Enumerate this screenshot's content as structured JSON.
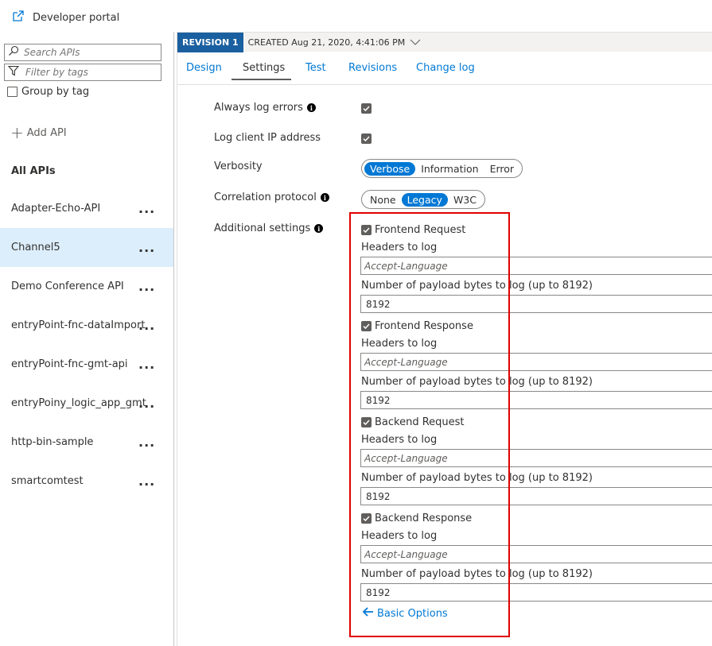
{
  "topbar": {
    "developer_portal": "Developer portal"
  },
  "sidebar": {
    "search_placeholder": "Search APIs",
    "filter_placeholder": "Filter by tags",
    "group_by_tag": "Group by tag",
    "add_api": "Add API",
    "all_apis": "All APIs",
    "apis": [
      {
        "name": "Adapter-Echo-API",
        "selected": false
      },
      {
        "name": "Channel5",
        "selected": true
      },
      {
        "name": "Demo Conference API",
        "selected": false
      },
      {
        "name": "entryPoint-fnc-dataImport",
        "selected": false
      },
      {
        "name": "entryPoint-fnc-gmt-api",
        "selected": false
      },
      {
        "name": "entryPoiny_logic_app_gmt",
        "selected": false
      },
      {
        "name": "http-bin-sample",
        "selected": false
      },
      {
        "name": "smartcomtest",
        "selected": false
      }
    ],
    "more": "..."
  },
  "revision": {
    "badge": "REVISION 1",
    "created": "CREATED Aug 21, 2020, 4:41:06 PM"
  },
  "tabs": [
    "Design",
    "Settings",
    "Test",
    "Revisions",
    "Change log"
  ],
  "active_tab": "Settings",
  "settings": {
    "always_log_errors": {
      "label": "Always log errors",
      "checked": true
    },
    "log_client_ip": {
      "label": "Log client IP address",
      "checked": true
    },
    "verbosity": {
      "label": "Verbosity",
      "options": [
        "Verbose",
        "Information",
        "Error"
      ],
      "selected": "Verbose"
    },
    "correlation_protocol": {
      "label": "Correlation protocol",
      "options": [
        "None",
        "Legacy",
        "W3C"
      ],
      "selected": "Legacy"
    },
    "additional_settings": {
      "label": "Additional settings"
    }
  },
  "advanced": {
    "headers_label": "Headers to log",
    "headers_placeholder": "Accept-Language",
    "payload_label": "Number of payload bytes to log (up to 8192)",
    "sections": [
      {
        "title": "Frontend Request",
        "checked": true,
        "payload": "8192"
      },
      {
        "title": "Frontend Response",
        "checked": true,
        "payload": "8192"
      },
      {
        "title": "Backend Request",
        "checked": true,
        "payload": "8192"
      },
      {
        "title": "Backend Response",
        "checked": true,
        "payload": "8192"
      }
    ],
    "basic_options": "Basic Options"
  },
  "colors": {
    "accent": "#0078d4",
    "revision_badge": "#1a5fa0",
    "selected_row": "#dceefb",
    "highlight_box": "#e00000"
  },
  "icons": [
    "external-link-icon",
    "search-icon",
    "filter-icon",
    "info-icon",
    "checkbox-checked-icon",
    "chevron-down-icon",
    "back-arrow-icon"
  ]
}
